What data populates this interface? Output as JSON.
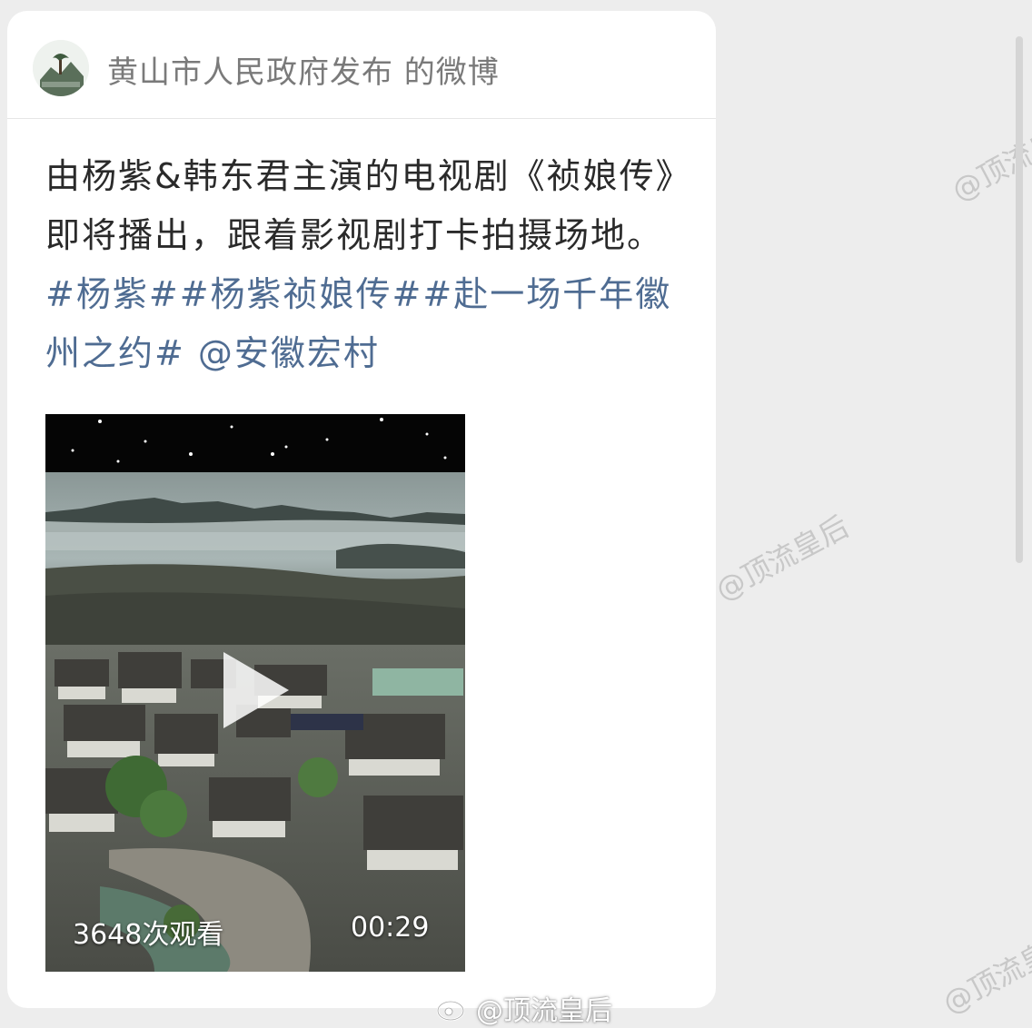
{
  "post": {
    "account_title": "黄山市人民政府发布 的微博",
    "text_plain": "由杨紫&韩东君主演的电视剧《祯娘传》即将播出，跟着影视剧打卡拍摄场地。",
    "hashtags": [
      "#杨紫#",
      "#杨紫祯娘传#",
      "#赴一场千年徽州之约#"
    ],
    "mention": " @安徽宏村"
  },
  "video": {
    "views": "3648次观看",
    "duration": "00:29"
  },
  "watermark": {
    "side_text": "@顶流皇后",
    "bottom_text": "@顶流皇后"
  },
  "colors": {
    "link": "#4f6c92",
    "text": "#2a2a2a",
    "muted": "#7a7a7a",
    "background": "#ededed"
  },
  "icons": [
    "avatar",
    "play-icon",
    "weibo-icon"
  ]
}
